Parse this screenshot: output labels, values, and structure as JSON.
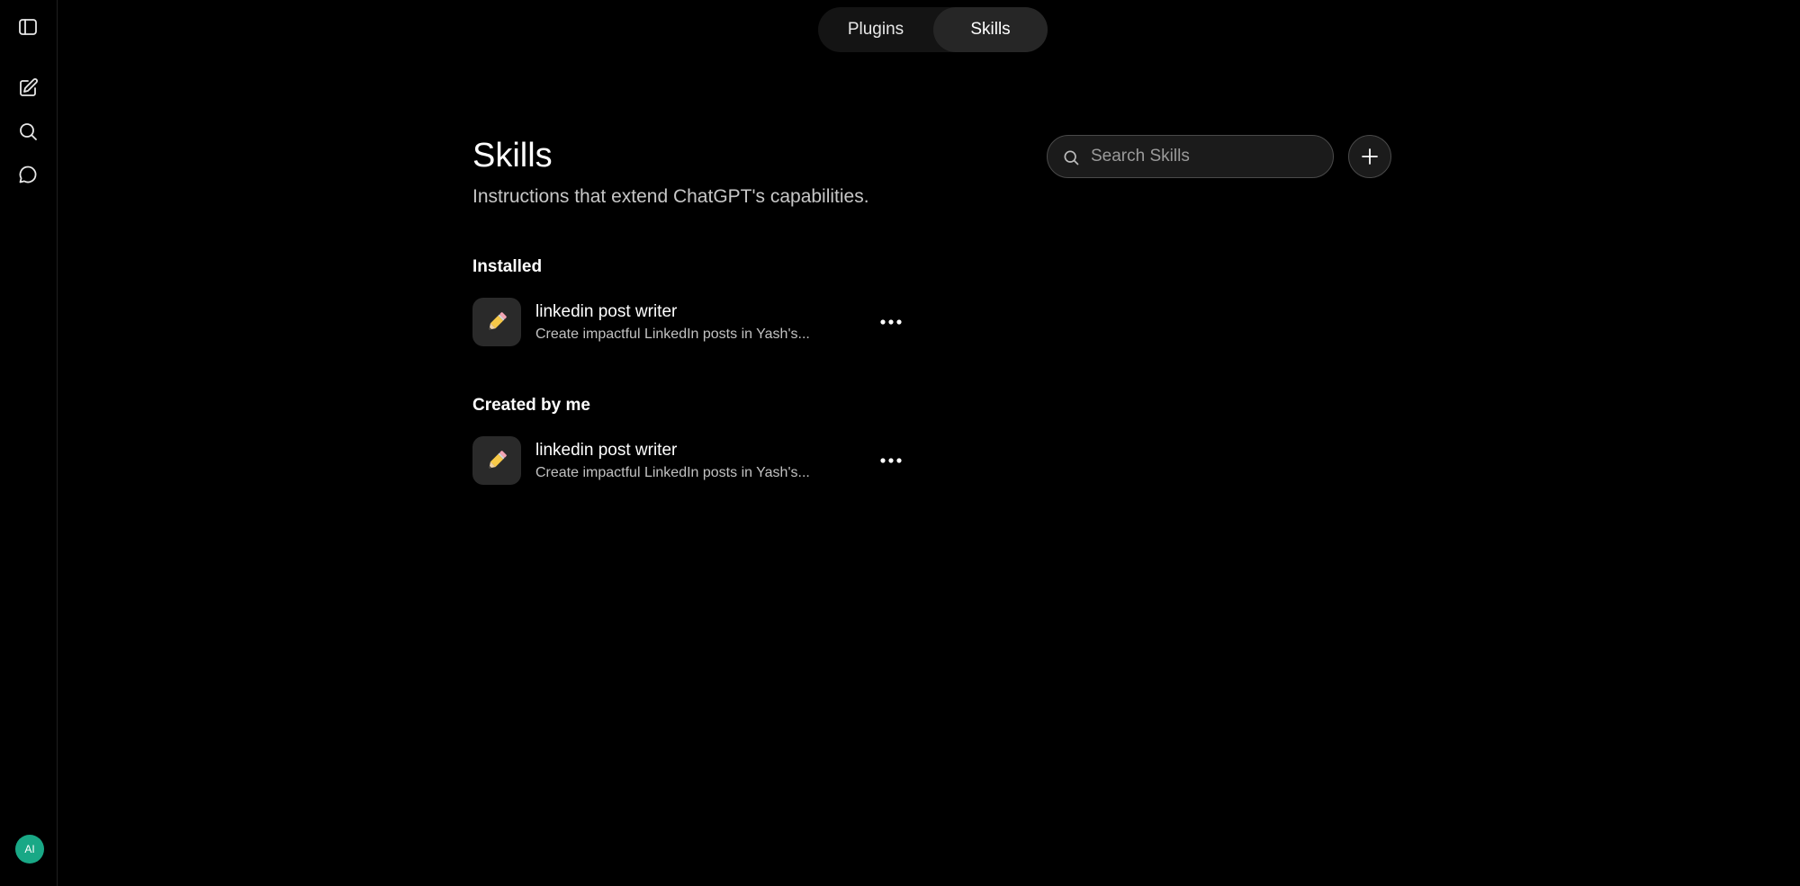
{
  "tabs": {
    "plugins_label": "Plugins",
    "skills_label": "Skills",
    "active": "Skills"
  },
  "sidebar": {
    "icons": [
      "sidebar-toggle-icon",
      "new-chat-icon",
      "search-icon",
      "chat-icon"
    ],
    "avatar_initials": "AI",
    "avatar_color": "#19a886"
  },
  "header": {
    "title": "Skills",
    "subtitle": "Instructions that extend ChatGPT's capabilities."
  },
  "search": {
    "placeholder": "Search Skills",
    "value": ""
  },
  "sections": {
    "installed": {
      "heading": "Installed",
      "items": [
        {
          "name": "linkedin post writer",
          "description": "Create impactful LinkedIn posts in Yash's...",
          "icon": "pencil-icon"
        }
      ]
    },
    "created": {
      "heading": "Created by me",
      "items": [
        {
          "name": "linkedin post writer",
          "description": "Create impactful LinkedIn posts in Yash's...",
          "icon": "pencil-icon"
        }
      ]
    }
  },
  "colors": {
    "background": "#000000",
    "tab_active_bg": "#262626",
    "tab_track_bg": "#141414",
    "icon_tile_bg": "#2a2a2a"
  }
}
